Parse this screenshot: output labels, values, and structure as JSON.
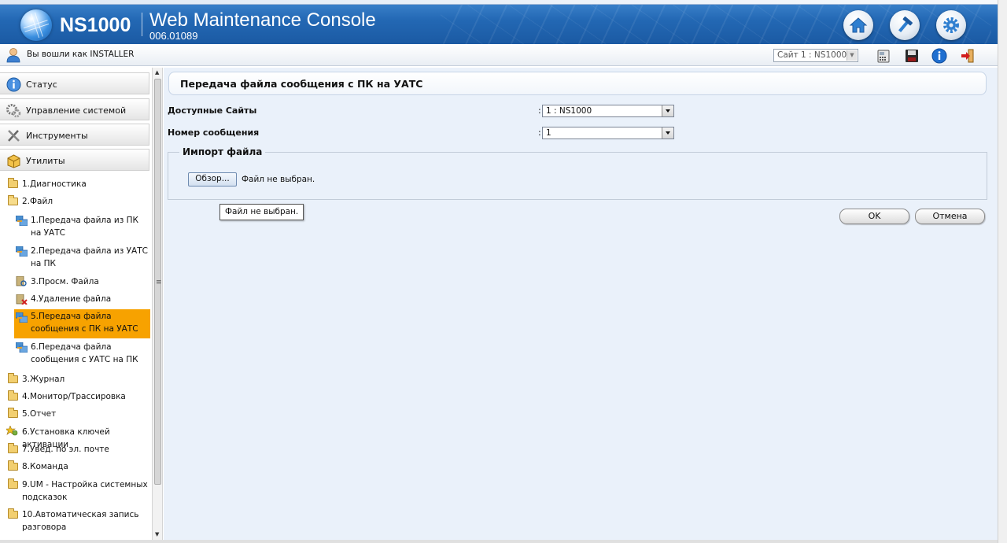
{
  "header": {
    "model": "NS1000",
    "console_title": "Web Maintenance Console",
    "version": "006.01089"
  },
  "statusbar": {
    "login_text": "Вы вошли как INSTALLER",
    "site_value": "Сайт 1 : NS1000"
  },
  "sidebar": {
    "sections": [
      {
        "label": "Статус",
        "icon": "info-icon"
      },
      {
        "label": "Управление системой",
        "icon": "system-gears-icon"
      },
      {
        "label": "Инструменты",
        "icon": "tools-icon"
      },
      {
        "label": "Утилиты",
        "icon": "utilities-box-icon"
      }
    ],
    "tree": [
      {
        "label": "1.Диагностика",
        "icon": "folder-icon"
      },
      {
        "label": "2.Файл",
        "icon": "folder-open-icon"
      },
      {
        "label": "1.Передача файла из ПК на УАТС",
        "icon": "file-transfer-icon"
      },
      {
        "label": "2.Передача файла из УАТС на ПК",
        "icon": "file-transfer-icon"
      },
      {
        "label": "3.Просм. Файла",
        "icon": "file-view-icon"
      },
      {
        "label": "4.Удаление файла",
        "icon": "file-delete-icon"
      },
      {
        "label": "5.Передача файла сообщения с ПК на УАТС",
        "icon": "file-transfer-icon",
        "selected": true
      },
      {
        "label": "6.Передача файла сообщения с УАТС на ПК",
        "icon": "file-transfer-icon"
      },
      {
        "label": "3.Журнал",
        "icon": "folder-icon"
      },
      {
        "label": "4.Монитор/Трассировка",
        "icon": "folder-icon"
      },
      {
        "label": "5.Отчет",
        "icon": "folder-icon"
      },
      {
        "label": "6.Установка ключей активации",
        "icon": "activation-key-icon"
      },
      {
        "label": "7.Увед. по эл. почте",
        "icon": "folder-icon"
      },
      {
        "label": "8.Команда",
        "icon": "folder-icon"
      },
      {
        "label": "9.UM - Настройка системных подсказок",
        "icon": "folder-icon"
      },
      {
        "label": "10.Автоматическая запись разговора",
        "icon": "folder-icon"
      }
    ]
  },
  "main": {
    "title": "Передача файла сообщения с ПК на УАТС",
    "fields": [
      {
        "label": "Доступные Сайты",
        "colon": ":",
        "value": "1 : NS1000"
      },
      {
        "label": "Номер сообщения",
        "colon": ":",
        "value": "1"
      }
    ],
    "import_legend": "Импорт файла",
    "browse_label": "Обзор...",
    "no_file_text": "Файл не выбран.",
    "tooltip_text": "Файл не выбран.",
    "ok_label": "OK",
    "cancel_label": "Отмена"
  },
  "colors": {
    "header_blue": "#2368b4",
    "selected_item": "#f7a200",
    "content_bg": "#eaf1fa"
  }
}
